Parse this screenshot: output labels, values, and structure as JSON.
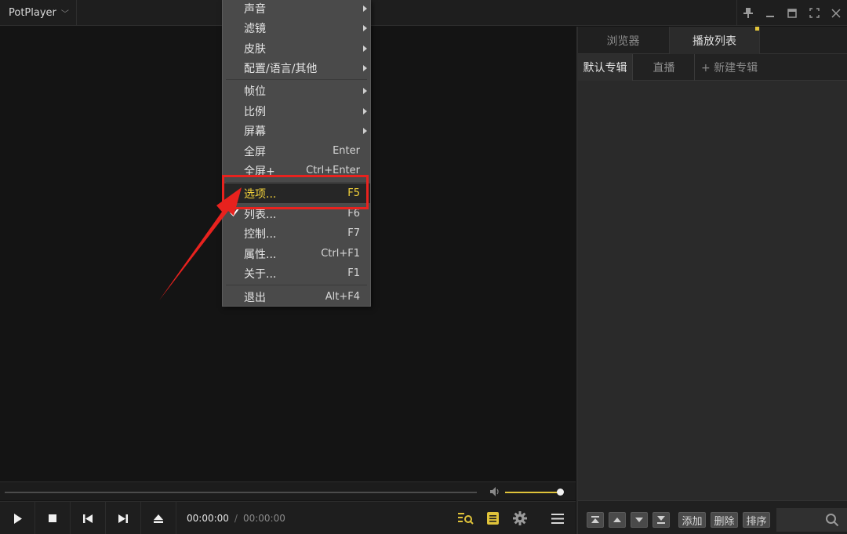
{
  "app": {
    "title": "PotPlayer"
  },
  "window_controls": [
    "pin-icon",
    "minimize-icon",
    "maximize-icon",
    "fullscreen-icon",
    "close-icon"
  ],
  "menu": {
    "items": [
      {
        "label": "声音",
        "submenu": true
      },
      {
        "label": "滤镜",
        "submenu": true
      },
      {
        "label": "皮肤",
        "submenu": true
      },
      {
        "label": "配置/语言/其他",
        "submenu": true
      },
      {
        "label": "帧位",
        "submenu": true
      },
      {
        "label": "比例",
        "submenu": true
      },
      {
        "label": "屏幕",
        "submenu": true
      },
      {
        "label": "全屏",
        "shortcut": "Enter"
      },
      {
        "label": "全屏+",
        "shortcut": "Ctrl+Enter"
      },
      {
        "label": "选项...",
        "shortcut": "F5",
        "highlighted": true
      },
      {
        "label": "列表...",
        "shortcut": "F6",
        "checked": true
      },
      {
        "label": "控制...",
        "shortcut": "F7"
      },
      {
        "label": "属性...",
        "shortcut": "Ctrl+F1"
      },
      {
        "label": "关于...",
        "shortcut": "F1"
      },
      {
        "label": "退出",
        "shortcut": "Alt+F4"
      }
    ]
  },
  "panel": {
    "tabs": [
      "浏览器",
      "播放列表"
    ],
    "active_tab": "播放列表",
    "subtabs": [
      "默认专辑",
      "直播",
      "+ 新建专辑"
    ],
    "buttons": {
      "add": "添加",
      "delete": "删除",
      "sort": "排序"
    }
  },
  "player": {
    "current_time": "00:00:00",
    "separator": "/",
    "total_time": "00:00:00",
    "volume": 1.0,
    "progress": 0
  },
  "colors": {
    "accent": "#f3d23a",
    "annotation": "#e8221e",
    "menu_bg": "#4a4a4a"
  }
}
